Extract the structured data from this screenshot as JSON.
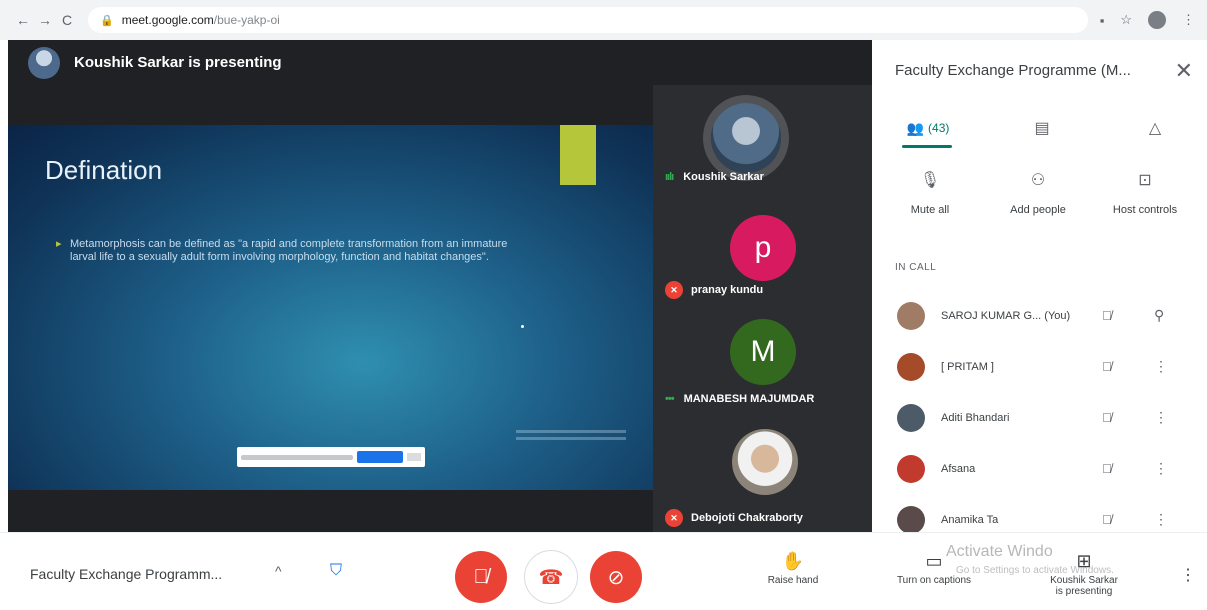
{
  "browser": {
    "url_host": "meet.google.com",
    "url_path": "/bue-yakp-oi",
    "back_icon": "←",
    "forward_icon": "→",
    "reload_icon": "C"
  },
  "presenter": {
    "label": "Koushik Sarkar is presenting"
  },
  "slide": {
    "title": "Defination",
    "bullet": "Metamorphosis can be defined as \"a rapid and complete transformation from an immature larval life to a sexually adult form involving morphology, function and habitat changes\"."
  },
  "tiles": [
    {
      "name": "Koushik Sarkar",
      "initial": "",
      "status": "speaking",
      "color": "#6b7c8c"
    },
    {
      "name": "pranay kundu",
      "initial": "p",
      "status": "muted",
      "color": "#d81b60"
    },
    {
      "name": "MANABESH MAJUMDAR",
      "initial": "M",
      "status": "speaking",
      "color": "#33691e"
    },
    {
      "name": "Debojoti Chakraborty",
      "initial": "",
      "status": "muted",
      "color": "#8d8479"
    }
  ],
  "panel": {
    "title": "Faculty Exchange Programme (M...",
    "people_count": "(43)",
    "actions": {
      "mute_all": "Mute all",
      "add_people": "Add people",
      "host_controls": "Host controls"
    },
    "in_call_label": "IN CALL",
    "people": [
      {
        "name": "SAROJ KUMAR G...  (You)",
        "color": "#a07c67"
      },
      {
        "name": "[ PRITAM ]",
        "color": "#a64b2a"
      },
      {
        "name": "Aditi Bhandari",
        "color": "#4d5b68"
      },
      {
        "name": "Afsana",
        "color": "#c23a2e"
      },
      {
        "name": "Anamika Ta",
        "color": "#5a4a4a"
      }
    ]
  },
  "bottom": {
    "meeting_name": "Faculty Exchange Programm...",
    "raise_hand": "Raise hand",
    "captions": "Turn on captions",
    "presenting_line1": "Koushik Sarkar",
    "presenting_line2": "is presenting",
    "activate_title": "Activate Windo",
    "activate_sub": "Go to Settings to activate Windows."
  }
}
